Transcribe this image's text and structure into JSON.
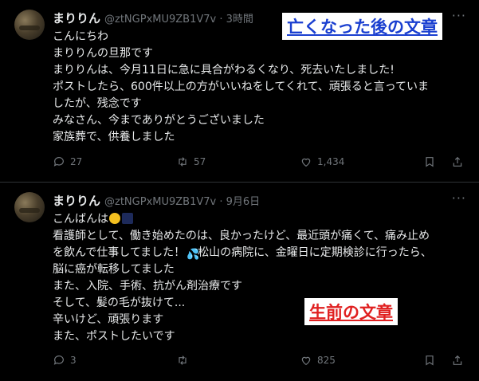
{
  "tweets": [
    {
      "name": "まりりん",
      "handle": "@ztNGPxMU9ZB1V7v · 3時間",
      "lines": [
        "こんにちわ",
        "まりりんの旦那です",
        "まりりんは、今月11日に急に具合がわるくなり、死去いたしました!",
        "ポストしたら、600件以上の方がいいねをしてくれて、頑張ると言っていま",
        "したが、残念です",
        "みなさん、今までありがとうございました",
        "家族葬で、供養しました"
      ],
      "reply_count": "27",
      "retweet_count": "57",
      "like_count": "1,434"
    },
    {
      "name": "まりりん",
      "handle": "@ztNGPxMU9ZB1V7v · 9月6日",
      "line0_text": "こんばんは",
      "line2_pre": "を飲んで仕事してました！",
      "line2_post": "松山の病院に、金曜日に定期検診に行ったら、",
      "lines": [
        "看護師として、働き始めたのは、良かったけど、最近頭が痛くて、痛み止め",
        "脳に癌が転移してました",
        "また、入院、手術、抗がん剤治療です",
        "そして、髪の毛が抜けて...",
        "辛いけど、頑張ります",
        "また、ポストしたいです"
      ],
      "reply_count": "3",
      "retweet_count": "",
      "like_count": "825"
    }
  ],
  "annotations": {
    "after": "亡くなった後の文章",
    "before": "生前の文章"
  },
  "colors": {
    "background": "#000000",
    "text": "#e7e9ea",
    "muted": "#71767b",
    "label_after": "#1a3fd0",
    "label_before": "#e02020"
  },
  "icons": {
    "more": "more-icon",
    "reply": "reply-icon",
    "retweet": "retweet-icon",
    "like": "like-icon",
    "bookmark": "bookmark-icon",
    "share": "share-icon"
  }
}
